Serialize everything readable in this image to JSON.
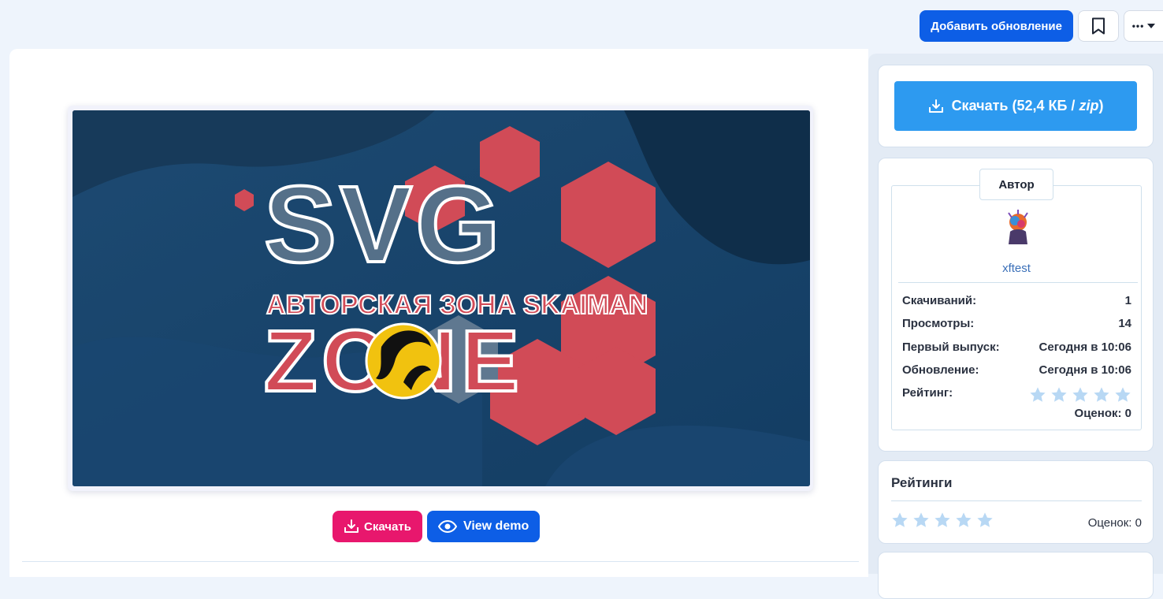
{
  "top_actions": {
    "add_update_label": "Добавить обновление",
    "bookmark_icon": "bookmark-icon",
    "more_label": "•••"
  },
  "cover": {
    "title_big": "SVG",
    "subtitle": "АВТОРСКАЯ ЗОНА SKAIMAN",
    "title_bottom": "ZONE"
  },
  "cover_actions": {
    "download_label": "Скачать",
    "view_demo_label": "View demo"
  },
  "sidebar": {
    "download_button": {
      "label_prefix": "Скачать (52,4 КБ / ",
      "label_ext": "zip",
      "label_suffix": ")"
    },
    "author": {
      "tab_label": "Автор",
      "name": "xftest",
      "stats": [
        {
          "label": "Скачиваний:",
          "value": "1"
        },
        {
          "label": "Просмотры:",
          "value": "14"
        },
        {
          "label": "Первый выпуск:",
          "value": "Сегодня в 10:06"
        },
        {
          "label": "Обновление:",
          "value": "Сегодня в 10:06"
        }
      ],
      "rating_label": "Рейтинг:",
      "rating_value": 0,
      "rating_count": "Оценок: 0"
    },
    "ratings": {
      "title": "Рейтинги",
      "count": "Оценок: 0"
    }
  },
  "colors": {
    "primary": "#0d5ee6",
    "download": "#2d9af0",
    "pink": "#e8176d",
    "star_empty": "#b8d8f4"
  }
}
